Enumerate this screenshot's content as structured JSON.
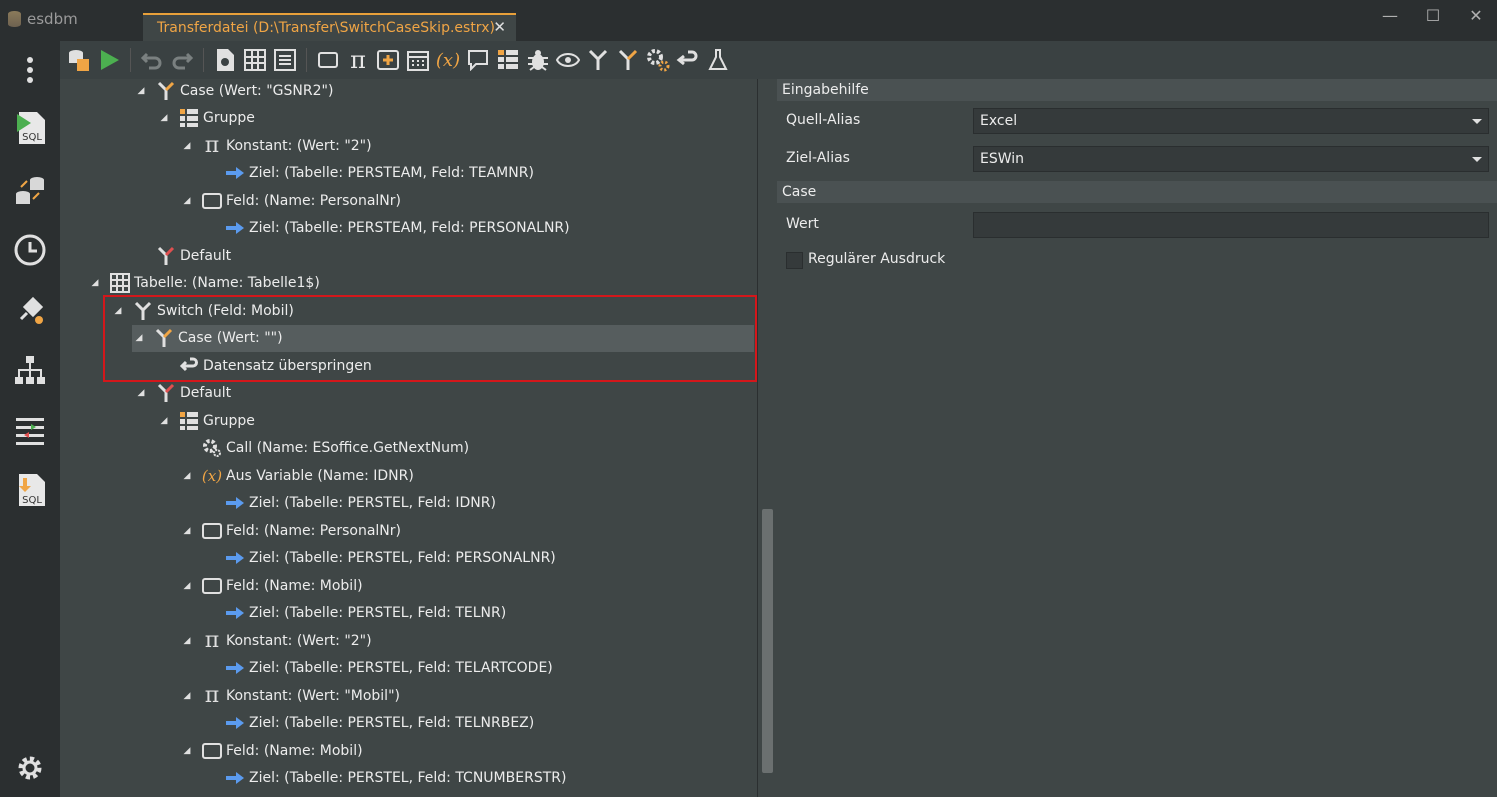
{
  "app": {
    "name": "esdbm"
  },
  "tab": {
    "title": "Transferdatei (D:\\Transfer\\SwitchCaseSkip.estrx)",
    "close": "✕"
  },
  "window": {
    "minimize": "—",
    "maximize": "☐",
    "close": "✕"
  },
  "sidebar": {
    "items": [
      {
        "name": "more-icon"
      },
      {
        "name": "sql-run-icon",
        "label": "SQL"
      },
      {
        "name": "db-transfer-icon"
      },
      {
        "name": "clock-icon"
      },
      {
        "name": "plugin-icon"
      },
      {
        "name": "hierarchy-icon"
      },
      {
        "name": "mapping-icon"
      },
      {
        "name": "sql-import-icon",
        "label": "SQL"
      },
      {
        "name": "gear-icon"
      }
    ]
  },
  "toolbar": {
    "buttons": [
      "db-config-icon",
      "run-icon",
      "undo-icon",
      "redo-icon",
      "file-settings-icon",
      "table-icon",
      "list-icon",
      "field-icon",
      "constant-icon",
      "add-icon",
      "calendar-icon",
      "variable-icon",
      "comment-icon",
      "group-icon",
      "bug-icon",
      "eye-icon",
      "switch-icon",
      "case-icon",
      "call-icon",
      "skip-icon",
      "flask-icon"
    ]
  },
  "tree": {
    "rows": [
      {
        "indent": 3,
        "arrow": "◢",
        "icon": "case",
        "text": "Case (Wert: \"GSNR2\")"
      },
      {
        "indent": 4,
        "arrow": "◢",
        "icon": "group",
        "text": "Gruppe"
      },
      {
        "indent": 5,
        "arrow": "◢",
        "icon": "pi",
        "text": "Konstant: (Wert: \"2\")"
      },
      {
        "indent": 6,
        "arrow": "",
        "icon": "target",
        "text": "Ziel: (Tabelle: PERSTEAM, Feld: TEAMNR)"
      },
      {
        "indent": 5,
        "arrow": "◢",
        "icon": "field",
        "text": "Feld: (Name: PersonalNr)"
      },
      {
        "indent": 6,
        "arrow": "",
        "icon": "target",
        "text": "Ziel: (Tabelle: PERSTEAM, Feld: PERSONALNR)"
      },
      {
        "indent": 3,
        "arrow": "",
        "icon": "default",
        "text": "Default"
      },
      {
        "indent": 1,
        "arrow": "◢",
        "icon": "table",
        "text": "Tabelle: (Name: Tabelle1$)"
      },
      {
        "indent": 2,
        "arrow": "◢",
        "icon": "switch",
        "text": "Switch (Feld: Mobil)"
      },
      {
        "indent": 3,
        "arrow": "◢",
        "icon": "case",
        "text": "Case (Wert: \"\")",
        "selected": true
      },
      {
        "indent": 4,
        "arrow": "",
        "icon": "skip",
        "text": "Datensatz überspringen"
      },
      {
        "indent": 3,
        "arrow": "◢",
        "icon": "default",
        "text": "Default"
      },
      {
        "indent": 4,
        "arrow": "◢",
        "icon": "group",
        "text": "Gruppe"
      },
      {
        "indent": 5,
        "arrow": "",
        "icon": "call",
        "text": "Call (Name: ESoffice.GetNextNum)"
      },
      {
        "indent": 5,
        "arrow": "◢",
        "icon": "var",
        "text": "Aus Variable (Name: IDNR)"
      },
      {
        "indent": 6,
        "arrow": "",
        "icon": "target",
        "text": "Ziel: (Tabelle: PERSTEL, Feld: IDNR)"
      },
      {
        "indent": 5,
        "arrow": "◢",
        "icon": "field",
        "text": "Feld: (Name: PersonalNr)"
      },
      {
        "indent": 6,
        "arrow": "",
        "icon": "target",
        "text": "Ziel: (Tabelle: PERSTEL, Feld: PERSONALNR)"
      },
      {
        "indent": 5,
        "arrow": "◢",
        "icon": "field",
        "text": "Feld: (Name: Mobil)"
      },
      {
        "indent": 6,
        "arrow": "",
        "icon": "target",
        "text": "Ziel: (Tabelle: PERSTEL, Feld: TELNR)"
      },
      {
        "indent": 5,
        "arrow": "◢",
        "icon": "pi",
        "text": "Konstant: (Wert: \"2\")"
      },
      {
        "indent": 6,
        "arrow": "",
        "icon": "target",
        "text": "Ziel: (Tabelle: PERSTEL, Feld: TELARTCODE)"
      },
      {
        "indent": 5,
        "arrow": "◢",
        "icon": "pi",
        "text": "Konstant: (Wert: \"Mobil\")"
      },
      {
        "indent": 6,
        "arrow": "",
        "icon": "target",
        "text": "Ziel: (Tabelle: PERSTEL, Feld: TELNRBEZ)"
      },
      {
        "indent": 5,
        "arrow": "◢",
        "icon": "field",
        "text": "Feld: (Name: Mobil)"
      },
      {
        "indent": 6,
        "arrow": "",
        "icon": "target",
        "text": "Ziel: (Tabelle: PERSTEL, Feld: TCNUMBERSTR)"
      }
    ]
  },
  "props": {
    "section1": "Eingabehilfe",
    "quell_label": "Quell-Alias",
    "quell_value": "Excel",
    "ziel_label": "Ziel-Alias",
    "ziel_value": "ESWin",
    "section2": "Case",
    "wert_label": "Wert",
    "wert_value": "",
    "regex_label": "Regulärer Ausdruck",
    "regex_checked": false
  },
  "colors": {
    "accent": "#f0a545",
    "highlight": "#d4171b",
    "target_arrow": "#5b9bef",
    "case_icon": "#f0a545",
    "default_icon": "#e05050"
  }
}
